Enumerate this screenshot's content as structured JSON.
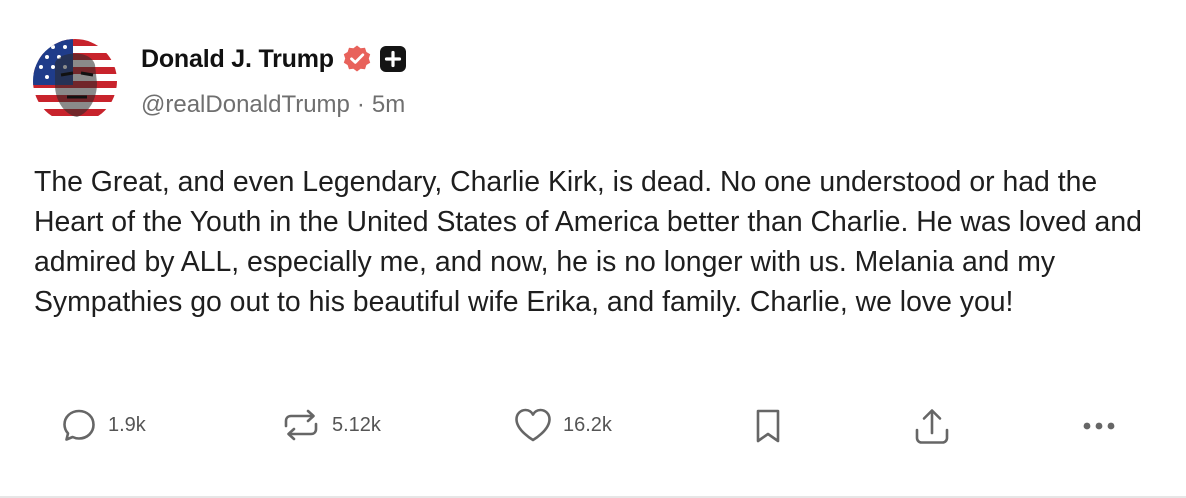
{
  "post": {
    "author": {
      "display_name": "Donald J. Trump",
      "handle": "@realDonaldTrump",
      "verified_icon": "verified-badge-icon",
      "plus_icon": "plus-badge-icon"
    },
    "separator": "·",
    "time_ago": "5m",
    "text": "The Great, and even Legendary, Charlie Kirk, is dead. No one understood or had the Heart of the Youth in the United States of America better than Charlie. He was loved and admired by ALL, especially me, and now, he is no longer with us. Melania and my Sympathies go out to his beautiful wife Erika, and family. Charlie, we love you!",
    "actions": {
      "reply": {
        "icon": "reply-icon",
        "count": "1.9k"
      },
      "retruth": {
        "icon": "repost-icon",
        "count": "5.12k"
      },
      "like": {
        "icon": "heart-icon",
        "count": "16.2k"
      },
      "bookmark": {
        "icon": "bookmark-icon"
      },
      "share": {
        "icon": "share-icon"
      },
      "more": {
        "icon": "more-icon"
      }
    }
  },
  "colors": {
    "verified_badge": "#e8625b",
    "text_primary": "#1e1e1e",
    "text_secondary": "#6f6f6f",
    "icon_gray": "#666666"
  }
}
